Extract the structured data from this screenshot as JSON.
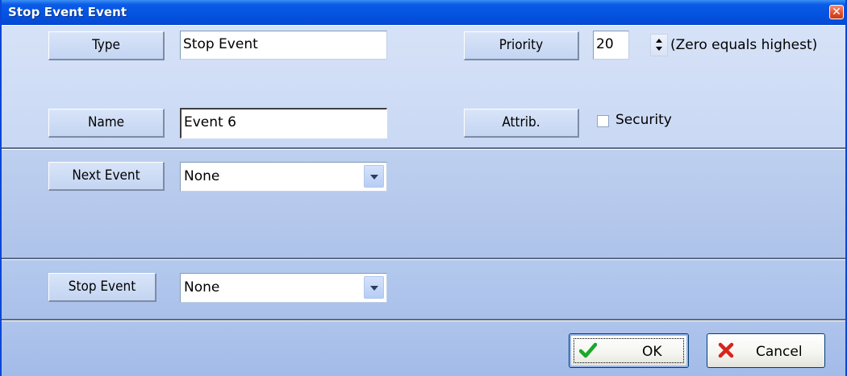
{
  "window": {
    "title": "Stop Event Event"
  },
  "general": {
    "type_label": "Type",
    "type_value": "Stop Event",
    "name_label": "Name",
    "name_value": "Event 6",
    "priority_label": "Priority",
    "priority_value": "20",
    "priority_hint": "(Zero equals highest)",
    "attrib_label": "Attrib.",
    "security_label": "Security",
    "security_checked": false
  },
  "next_event": {
    "label": "Next Event",
    "selected": "None"
  },
  "stop_event": {
    "label": "Stop Event",
    "selected": "None"
  },
  "buttons": {
    "ok_label": "OK",
    "cancel_label": "Cancel"
  },
  "icons": {
    "close": "close-icon",
    "ok": "checkmark-icon",
    "cancel": "x-icon",
    "spinner": "spinner-arrows-icon",
    "dropdown": "chevron-down-icon"
  },
  "colors": {
    "titlebar": "#0453e0",
    "ok_check": "#1aa82a",
    "cancel_x": "#d8241b"
  }
}
